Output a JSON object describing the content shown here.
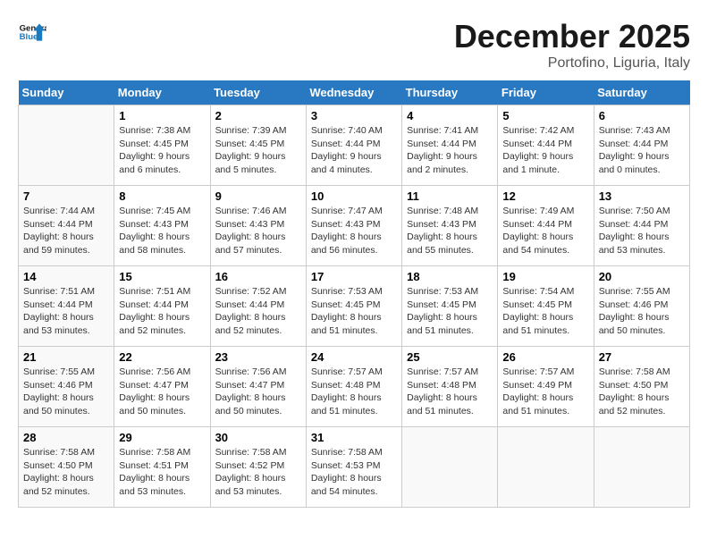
{
  "header": {
    "logo_general": "General",
    "logo_blue": "Blue",
    "month": "December 2025",
    "location": "Portofino, Liguria, Italy"
  },
  "weekdays": [
    "Sunday",
    "Monday",
    "Tuesday",
    "Wednesday",
    "Thursday",
    "Friday",
    "Saturday"
  ],
  "weeks": [
    [
      {
        "day": "",
        "sunrise": "",
        "sunset": "",
        "daylight": ""
      },
      {
        "day": "1",
        "sunrise": "Sunrise: 7:38 AM",
        "sunset": "Sunset: 4:45 PM",
        "daylight": "Daylight: 9 hours and 6 minutes."
      },
      {
        "day": "2",
        "sunrise": "Sunrise: 7:39 AM",
        "sunset": "Sunset: 4:45 PM",
        "daylight": "Daylight: 9 hours and 5 minutes."
      },
      {
        "day": "3",
        "sunrise": "Sunrise: 7:40 AM",
        "sunset": "Sunset: 4:44 PM",
        "daylight": "Daylight: 9 hours and 4 minutes."
      },
      {
        "day": "4",
        "sunrise": "Sunrise: 7:41 AM",
        "sunset": "Sunset: 4:44 PM",
        "daylight": "Daylight: 9 hours and 2 minutes."
      },
      {
        "day": "5",
        "sunrise": "Sunrise: 7:42 AM",
        "sunset": "Sunset: 4:44 PM",
        "daylight": "Daylight: 9 hours and 1 minute."
      },
      {
        "day": "6",
        "sunrise": "Sunrise: 7:43 AM",
        "sunset": "Sunset: 4:44 PM",
        "daylight": "Daylight: 9 hours and 0 minutes."
      }
    ],
    [
      {
        "day": "7",
        "sunrise": "Sunrise: 7:44 AM",
        "sunset": "Sunset: 4:44 PM",
        "daylight": "Daylight: 8 hours and 59 minutes."
      },
      {
        "day": "8",
        "sunrise": "Sunrise: 7:45 AM",
        "sunset": "Sunset: 4:43 PM",
        "daylight": "Daylight: 8 hours and 58 minutes."
      },
      {
        "day": "9",
        "sunrise": "Sunrise: 7:46 AM",
        "sunset": "Sunset: 4:43 PM",
        "daylight": "Daylight: 8 hours and 57 minutes."
      },
      {
        "day": "10",
        "sunrise": "Sunrise: 7:47 AM",
        "sunset": "Sunset: 4:43 PM",
        "daylight": "Daylight: 8 hours and 56 minutes."
      },
      {
        "day": "11",
        "sunrise": "Sunrise: 7:48 AM",
        "sunset": "Sunset: 4:43 PM",
        "daylight": "Daylight: 8 hours and 55 minutes."
      },
      {
        "day": "12",
        "sunrise": "Sunrise: 7:49 AM",
        "sunset": "Sunset: 4:44 PM",
        "daylight": "Daylight: 8 hours and 54 minutes."
      },
      {
        "day": "13",
        "sunrise": "Sunrise: 7:50 AM",
        "sunset": "Sunset: 4:44 PM",
        "daylight": "Daylight: 8 hours and 53 minutes."
      }
    ],
    [
      {
        "day": "14",
        "sunrise": "Sunrise: 7:51 AM",
        "sunset": "Sunset: 4:44 PM",
        "daylight": "Daylight: 8 hours and 53 minutes."
      },
      {
        "day": "15",
        "sunrise": "Sunrise: 7:51 AM",
        "sunset": "Sunset: 4:44 PM",
        "daylight": "Daylight: 8 hours and 52 minutes."
      },
      {
        "day": "16",
        "sunrise": "Sunrise: 7:52 AM",
        "sunset": "Sunset: 4:44 PM",
        "daylight": "Daylight: 8 hours and 52 minutes."
      },
      {
        "day": "17",
        "sunrise": "Sunrise: 7:53 AM",
        "sunset": "Sunset: 4:45 PM",
        "daylight": "Daylight: 8 hours and 51 minutes."
      },
      {
        "day": "18",
        "sunrise": "Sunrise: 7:53 AM",
        "sunset": "Sunset: 4:45 PM",
        "daylight": "Daylight: 8 hours and 51 minutes."
      },
      {
        "day": "19",
        "sunrise": "Sunrise: 7:54 AM",
        "sunset": "Sunset: 4:45 PM",
        "daylight": "Daylight: 8 hours and 51 minutes."
      },
      {
        "day": "20",
        "sunrise": "Sunrise: 7:55 AM",
        "sunset": "Sunset: 4:46 PM",
        "daylight": "Daylight: 8 hours and 50 minutes."
      }
    ],
    [
      {
        "day": "21",
        "sunrise": "Sunrise: 7:55 AM",
        "sunset": "Sunset: 4:46 PM",
        "daylight": "Daylight: 8 hours and 50 minutes."
      },
      {
        "day": "22",
        "sunrise": "Sunrise: 7:56 AM",
        "sunset": "Sunset: 4:47 PM",
        "daylight": "Daylight: 8 hours and 50 minutes."
      },
      {
        "day": "23",
        "sunrise": "Sunrise: 7:56 AM",
        "sunset": "Sunset: 4:47 PM",
        "daylight": "Daylight: 8 hours and 50 minutes."
      },
      {
        "day": "24",
        "sunrise": "Sunrise: 7:57 AM",
        "sunset": "Sunset: 4:48 PM",
        "daylight": "Daylight: 8 hours and 51 minutes."
      },
      {
        "day": "25",
        "sunrise": "Sunrise: 7:57 AM",
        "sunset": "Sunset: 4:48 PM",
        "daylight": "Daylight: 8 hours and 51 minutes."
      },
      {
        "day": "26",
        "sunrise": "Sunrise: 7:57 AM",
        "sunset": "Sunset: 4:49 PM",
        "daylight": "Daylight: 8 hours and 51 minutes."
      },
      {
        "day": "27",
        "sunrise": "Sunrise: 7:58 AM",
        "sunset": "Sunset: 4:50 PM",
        "daylight": "Daylight: 8 hours and 52 minutes."
      }
    ],
    [
      {
        "day": "28",
        "sunrise": "Sunrise: 7:58 AM",
        "sunset": "Sunset: 4:50 PM",
        "daylight": "Daylight: 8 hours and 52 minutes."
      },
      {
        "day": "29",
        "sunrise": "Sunrise: 7:58 AM",
        "sunset": "Sunset: 4:51 PM",
        "daylight": "Daylight: 8 hours and 53 minutes."
      },
      {
        "day": "30",
        "sunrise": "Sunrise: 7:58 AM",
        "sunset": "Sunset: 4:52 PM",
        "daylight": "Daylight: 8 hours and 53 minutes."
      },
      {
        "day": "31",
        "sunrise": "Sunrise: 7:58 AM",
        "sunset": "Sunset: 4:53 PM",
        "daylight": "Daylight: 8 hours and 54 minutes."
      },
      {
        "day": "",
        "sunrise": "",
        "sunset": "",
        "daylight": ""
      },
      {
        "day": "",
        "sunrise": "",
        "sunset": "",
        "daylight": ""
      },
      {
        "day": "",
        "sunrise": "",
        "sunset": "",
        "daylight": ""
      }
    ]
  ]
}
